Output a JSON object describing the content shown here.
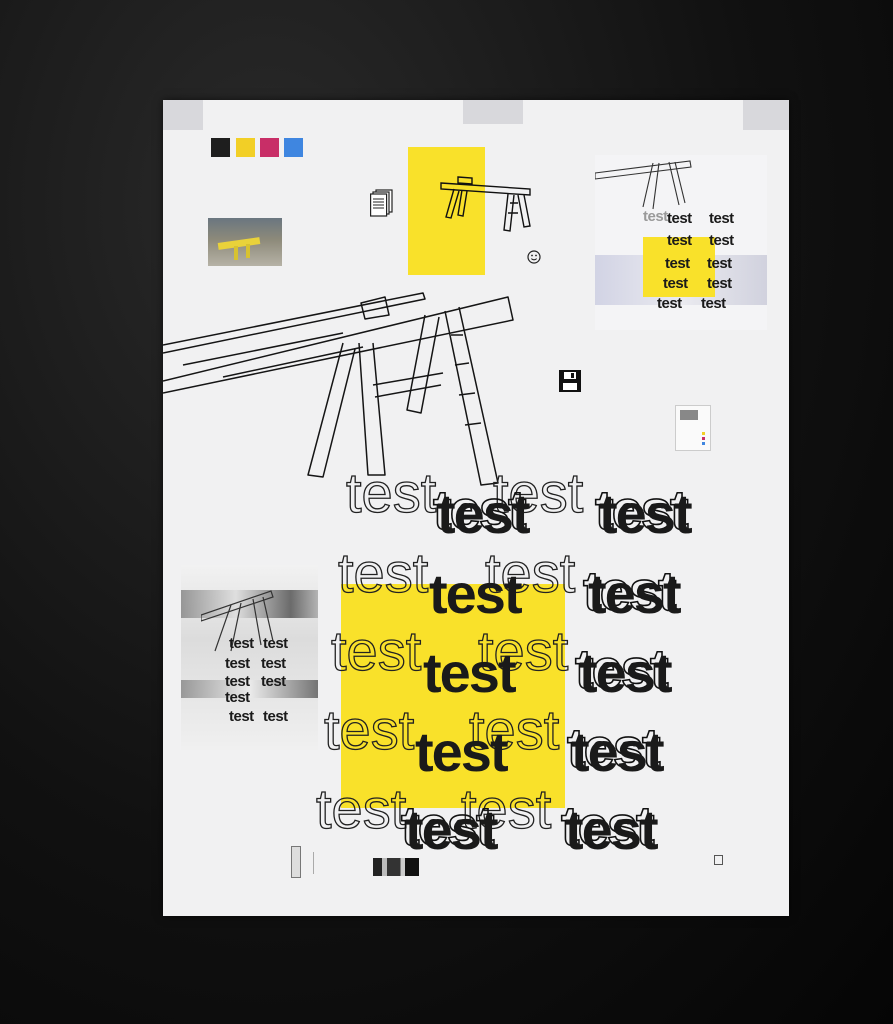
{
  "swatches": [
    "#1e1e1e",
    "#f2cf26",
    "#c82e67",
    "#3f86e0"
  ],
  "accent_yellow": "#f9e12a",
  "icons": [
    "document-stack-icon",
    "smiley-icon",
    "floppy-disk-icon",
    "mini-poster-icon"
  ],
  "words": {
    "w": "test"
  }
}
